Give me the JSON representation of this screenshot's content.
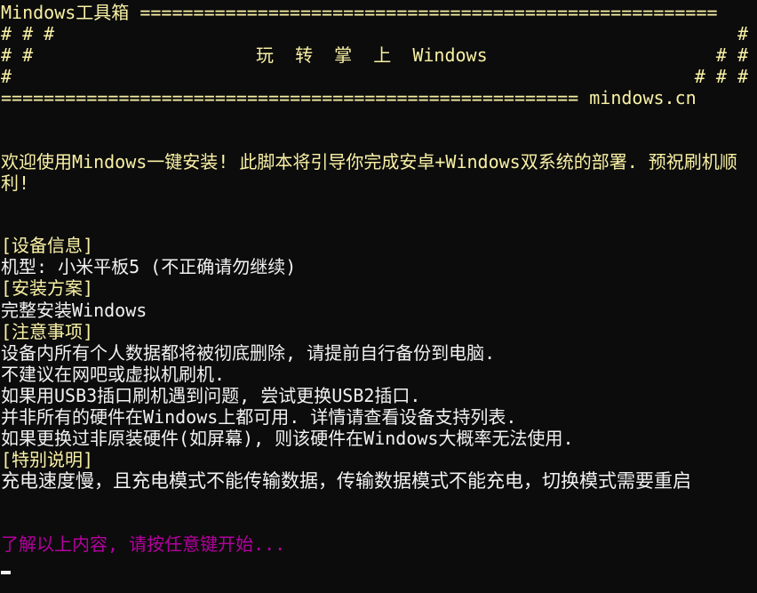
{
  "banner": {
    "title": "Mindows工具箱",
    "top_rule": "======================================================",
    "row1_left": "# # #",
    "row1_right": "#",
    "row2_left": "# #",
    "slogan": "玩  转  掌  上  Windows",
    "row2_right": "# #",
    "row3_left": "#",
    "row3_right": "# # #",
    "bottom_rule": "======================================================",
    "site": "mindows.cn"
  },
  "intro": "欢迎使用Mindows一键安装! 此脚本将引导你完成安卓+Windows双系统的部署. 预祝刷机顺利!",
  "sections": {
    "device_header": "[设备信息]",
    "device_model": "机型: 小米平板5 (不正确请勿继续)",
    "plan_header": "[安装方案]",
    "plan_value": "完整安装Windows",
    "notes_header": "[注意事项]",
    "notes": [
      "设备内所有个人数据都将被彻底删除, 请提前自行备份到电脑.",
      "不建议在网吧或虚拟机刷机.",
      "如果用USB3插口刷机遇到问题, 尝试更换USB2插口.",
      "并非所有的硬件在Windows上都可用. 详情请查看设备支持列表.",
      "如果更换过非原装硬件(如屏幕), 则该硬件在Windows大概率无法使用."
    ],
    "special_header": "[特别说明]",
    "special_text": "充电速度慢，且充电模式不能传输数据，传输数据模式不能充电，切换模式需要重启"
  },
  "prompt": "了解以上内容, 请按任意键开始...",
  "colors": {
    "background": "#0c0c0c",
    "banner": "#f9f1a5",
    "body_text": "#f2f2f2",
    "prompt": "#b4009e"
  }
}
